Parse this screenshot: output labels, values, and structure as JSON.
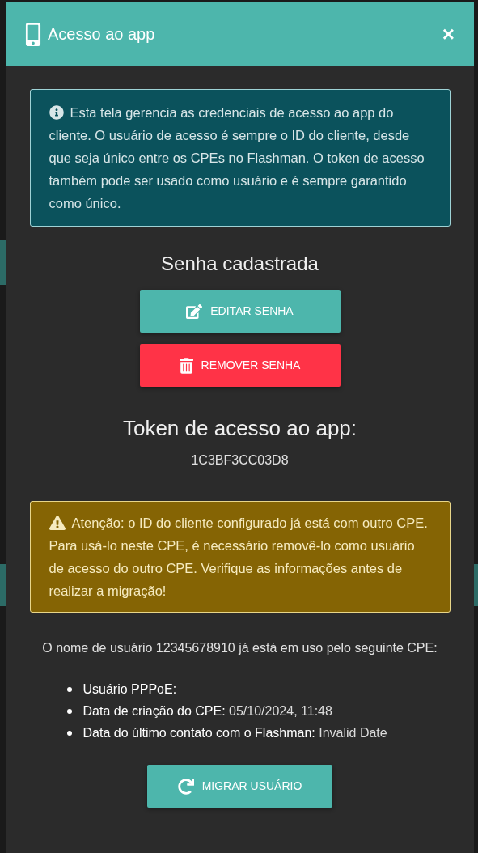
{
  "modal": {
    "title": "Acesso ao app",
    "close": "×"
  },
  "info": "Esta tela gerencia as credenciais de acesso ao app do cliente. O usuário de acesso é sempre o ID do cliente, desde que seja único entre os CPEs no Flashman. O token de acesso também pode ser usado como usuário e é sempre garantido como único.",
  "password_heading": "Senha cadastrada",
  "buttons": [
    {
      "kind": "edit",
      "label": "EDITAR SENHA"
    },
    {
      "kind": "remove",
      "label": "REMOVER SENHA"
    }
  ],
  "token": {
    "heading": "Token de acesso ao app:",
    "value": "1C3BF3CC03D8"
  },
  "warning": "Atenção: o ID do cliente configurado já está com outro CPE. Para usá-lo neste CPE, é necessário removê-lo como usuário de acesso do outro CPE. Verifique as informações antes de realizar a migração!",
  "conflict_text": "O nome de usuário 12345678910 já está em uso pelo seguinte CPE:",
  "details": [
    {
      "label": "Usuário PPPoE:"
    },
    {
      "label": "Data de criação do CPE:",
      "value": "05/10/2024, 11:48"
    },
    {
      "label": "Data do último contato com o Flashman:",
      "value": "Invalid Date"
    }
  ],
  "migrate_button": {
    "kind": "migrate",
    "label": "MIGRAR USUÁRIO"
  }
}
